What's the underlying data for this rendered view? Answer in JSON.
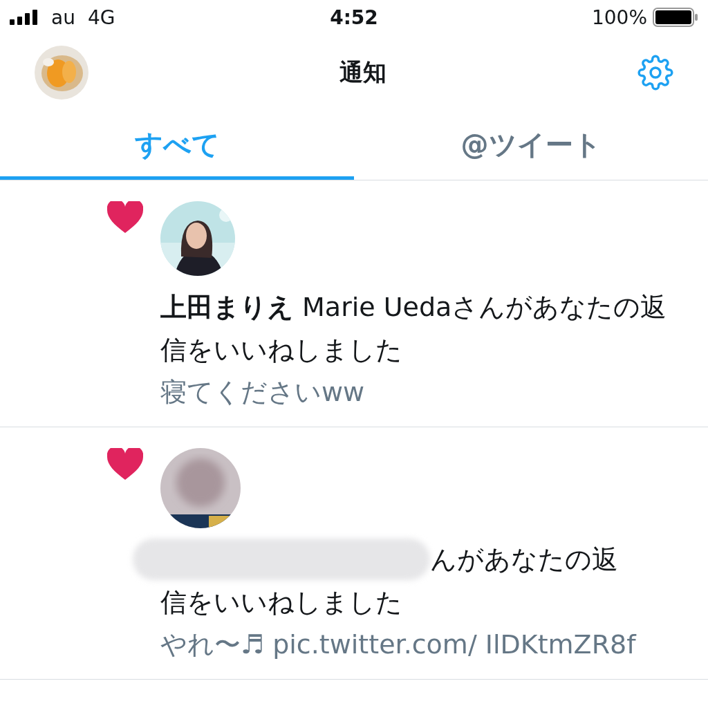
{
  "status_bar": {
    "carrier": "au",
    "network": "4G",
    "time": "4:52",
    "battery": "100%"
  },
  "header": {
    "title": "通知"
  },
  "tabs": [
    {
      "label": "すべて",
      "selected": true
    },
    {
      "label": "@ツイート",
      "selected": false
    }
  ],
  "notifications": [
    {
      "kind": "like",
      "lines": [
        "**上田まりえ** Marie Uedaさんがあなたの返信をいいねしました"
      ],
      "redacted": false,
      "tweet": "寝てくださいww"
    },
    {
      "kind": "like",
      "lines": [
        "んがあなたの返",
        "信をいいねしました"
      ],
      "redacted": true,
      "tweet": "やれ〜♬ pic.twitter.com/ IlDKtmZR8f"
    }
  ]
}
